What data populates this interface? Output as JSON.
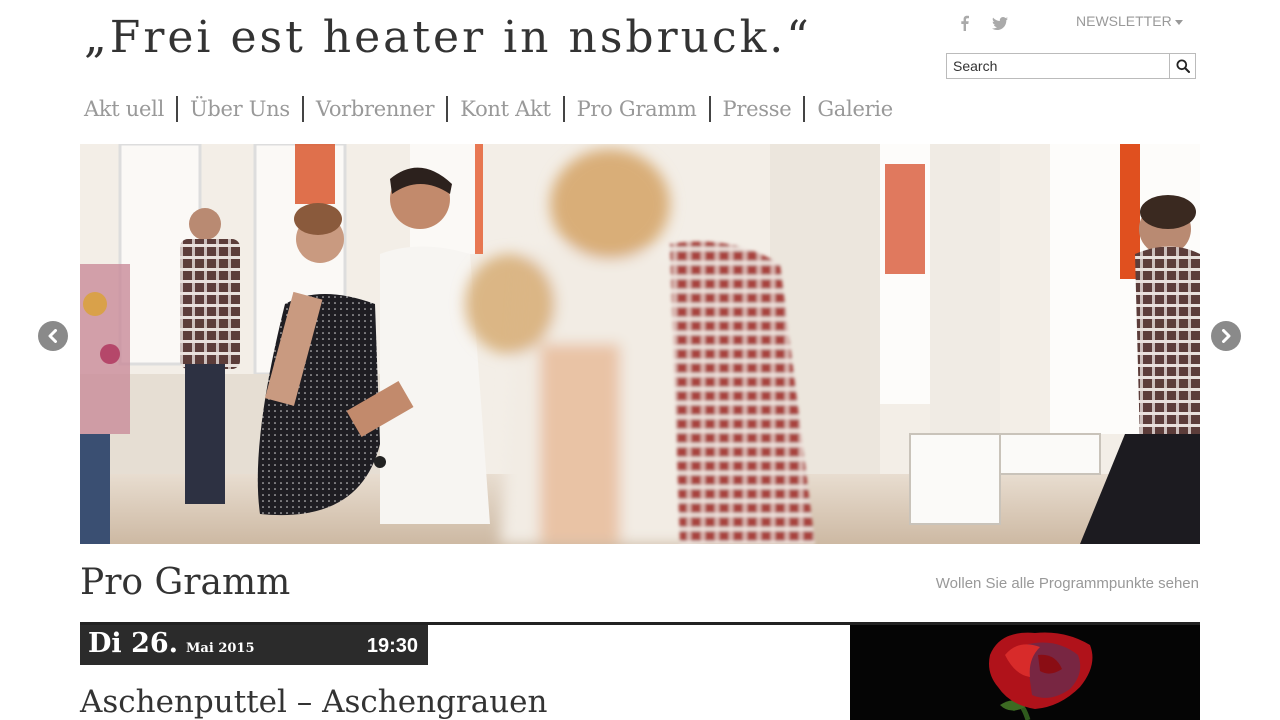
{
  "site": {
    "title": "„Frei est heater in nsbruck.“"
  },
  "header": {
    "social": [
      {
        "icon": "facebook-icon",
        "glyph": "f"
      },
      {
        "icon": "twitter-icon",
        "glyph": "t"
      }
    ],
    "newsletter_label": "NEWSLETTER",
    "search": {
      "placeholder": "Search",
      "value": ""
    }
  },
  "nav": {
    "items": [
      {
        "label": "Akt uell"
      },
      {
        "label": "Über Uns"
      },
      {
        "label": "Vorbrenner"
      },
      {
        "label": "Kont Akt"
      },
      {
        "label": "Pro Gramm"
      },
      {
        "label": "Presse"
      },
      {
        "label": "Galerie"
      }
    ]
  },
  "slider": {
    "prev_icon": "chevron-left-icon",
    "next_icon": "chevron-right-icon",
    "image_description": "people dancing in a bright room"
  },
  "program": {
    "title": "Pro Gramm",
    "all_link": "Wollen Sie alle Programmpunkte sehen",
    "event": {
      "day": "Di 26.",
      "month": "Mai 2015",
      "time": "19:30",
      "title": "Aschenputtel – Aschengrauen",
      "image": "red rose on black background"
    }
  },
  "colors": {
    "nav_text": "#999999",
    "date_bar": "#2b2b2b",
    "rose": "#b0121a"
  }
}
